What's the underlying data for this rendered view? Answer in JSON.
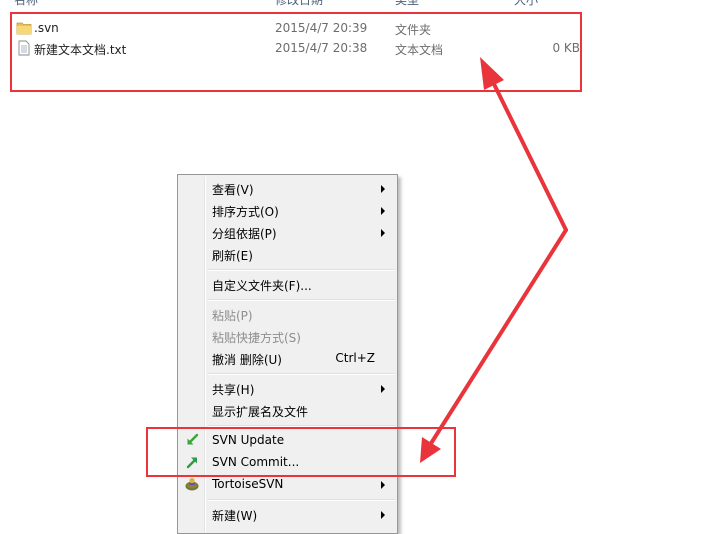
{
  "columns": {
    "name": "名称",
    "modified": "修改日期",
    "type": "类型",
    "size": "大小"
  },
  "files": [
    {
      "icon": "folder-icon",
      "name": ".svn",
      "date": "2015/4/7 20:39",
      "type": "文件夹",
      "size": ""
    },
    {
      "icon": "text-file-icon",
      "name": "新建文本文档.txt",
      "date": "2015/4/7 20:38",
      "type": "文本文档",
      "size": "0 KB"
    }
  ],
  "context_menu": {
    "view": "查看(V)",
    "sort_by": "排序方式(O)",
    "group_by": "分组依据(P)",
    "refresh": "刷新(E)",
    "customize_folder": "自定义文件夹(F)...",
    "paste": "粘贴(P)",
    "paste_shortcut": "粘贴快捷方式(S)",
    "undo_delete": "撤消 删除(U)",
    "undo_shortcut": "Ctrl+Z",
    "share": "共享(H)",
    "show_extensions": "显示扩展名及文件",
    "svn_update": "SVN Update",
    "svn_commit": "SVN Commit...",
    "tortoise_svn": "TortoiseSVN",
    "new": "新建(W)"
  },
  "colors": {
    "annotation_red": "#e8343a",
    "svn_update_green": "#3aa63a",
    "svn_commit_green": "#2e9c44"
  }
}
